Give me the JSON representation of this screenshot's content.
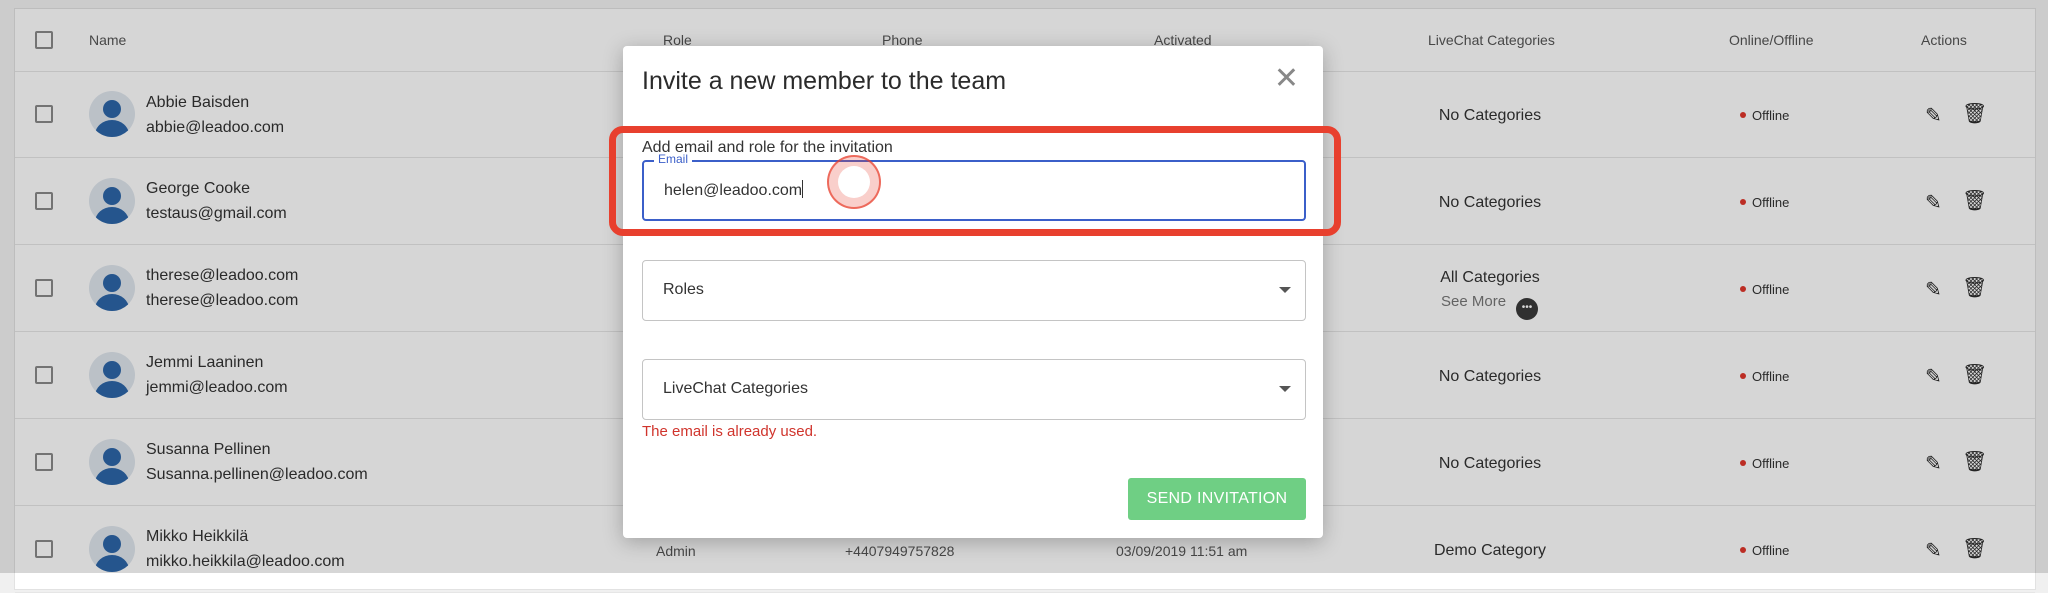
{
  "table": {
    "headers": {
      "name": "Name",
      "role": "Role",
      "phone": "Phone",
      "activated": "Activated",
      "categories": "LiveChat Categories",
      "online": "Online/Offline",
      "actions": "Actions"
    },
    "rows": [
      {
        "name": "Abbie Baisden",
        "email": "abbie@leadoo.com",
        "category": "No Categories",
        "status": "Offline"
      },
      {
        "name": "George Cooke",
        "email": "testaus@gmail.com",
        "category": "No Categories",
        "status": "Offline"
      },
      {
        "name": "therese@leadoo.com",
        "email": "therese@leadoo.com",
        "category": "All Categories",
        "see_more": "See More",
        "status": "Offline"
      },
      {
        "name": "Jemmi Laaninen",
        "email": "jemmi@leadoo.com",
        "category": "No Categories",
        "status": "Offline"
      },
      {
        "name": "Susanna Pellinen",
        "email": "Susanna.pellinen@leadoo.com",
        "category": "No Categories",
        "status": "Offline"
      },
      {
        "name": "Mikko Heikkilä",
        "email": "mikko.heikkila@leadoo.com",
        "role": "Admin",
        "phone": "+4407949757828",
        "activated": "03/09/2019 11:51 am",
        "category": "Demo Category",
        "status": "Offline"
      }
    ]
  },
  "modal": {
    "title": "Invite a new member to the team",
    "subtitle": "Add email and role for the invitation",
    "email_label": "Email",
    "email_value": "helen@leadoo.com",
    "roles_placeholder": "Roles",
    "categories_placeholder": "LiveChat Categories",
    "error": "The email is already used.",
    "send_label": "SEND INVITATION"
  },
  "colors": {
    "accent": "#3b5fc9",
    "send_button": "#6fcf84",
    "error": "#d0342c",
    "highlight": "#e8402e",
    "offline_dot": "#e0362b"
  },
  "icons": [
    "close-icon",
    "chevron-down-icon",
    "edit-icon",
    "trash-icon",
    "user-avatar-icon",
    "more-icon"
  ]
}
